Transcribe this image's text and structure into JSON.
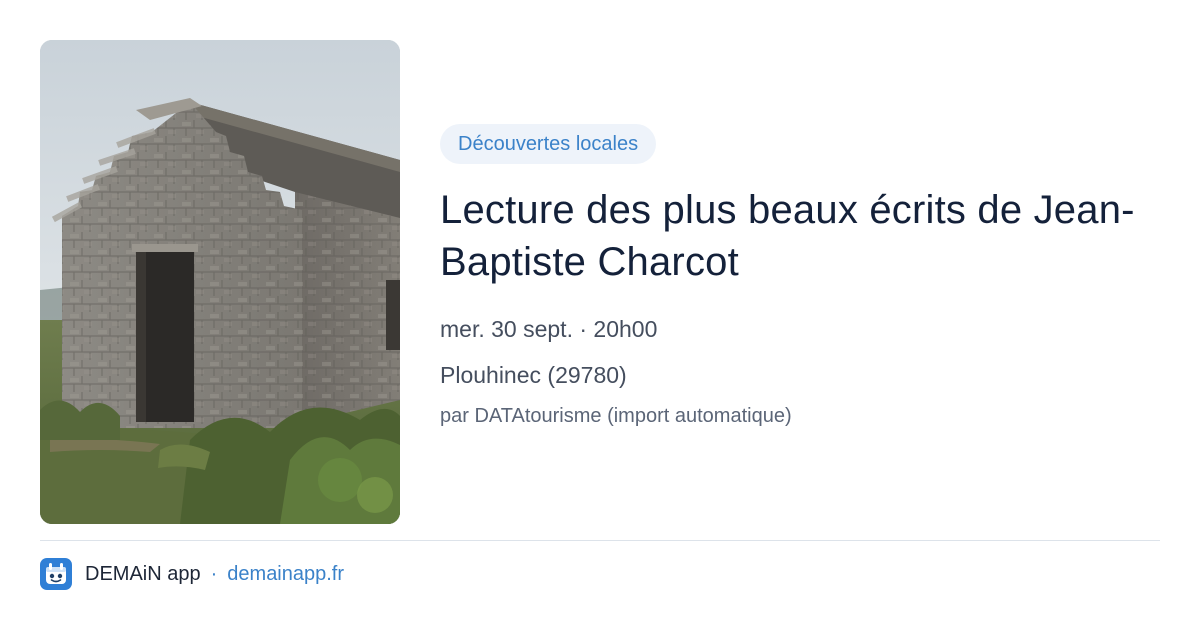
{
  "event": {
    "category": "Découvertes locales",
    "title": "Lecture des plus beaux écrits de Jean-Baptiste Charcot",
    "date_time": "mer. 30 sept. · 20h00",
    "location": "Plouhinec (29780)",
    "source": "par DATAtourisme (import automatique)",
    "image_icon": "stone-hut-photo"
  },
  "footer": {
    "app_name": "DEMAiN app",
    "separator": "·",
    "link": "demainapp.fr",
    "logo_icon": "demain-app-logo-icon"
  },
  "colors": {
    "accent": "#3b82c9",
    "badge_bg": "#eef3fa",
    "title": "#14213a",
    "meta": "#454e5e",
    "divider": "#dde3ea"
  }
}
